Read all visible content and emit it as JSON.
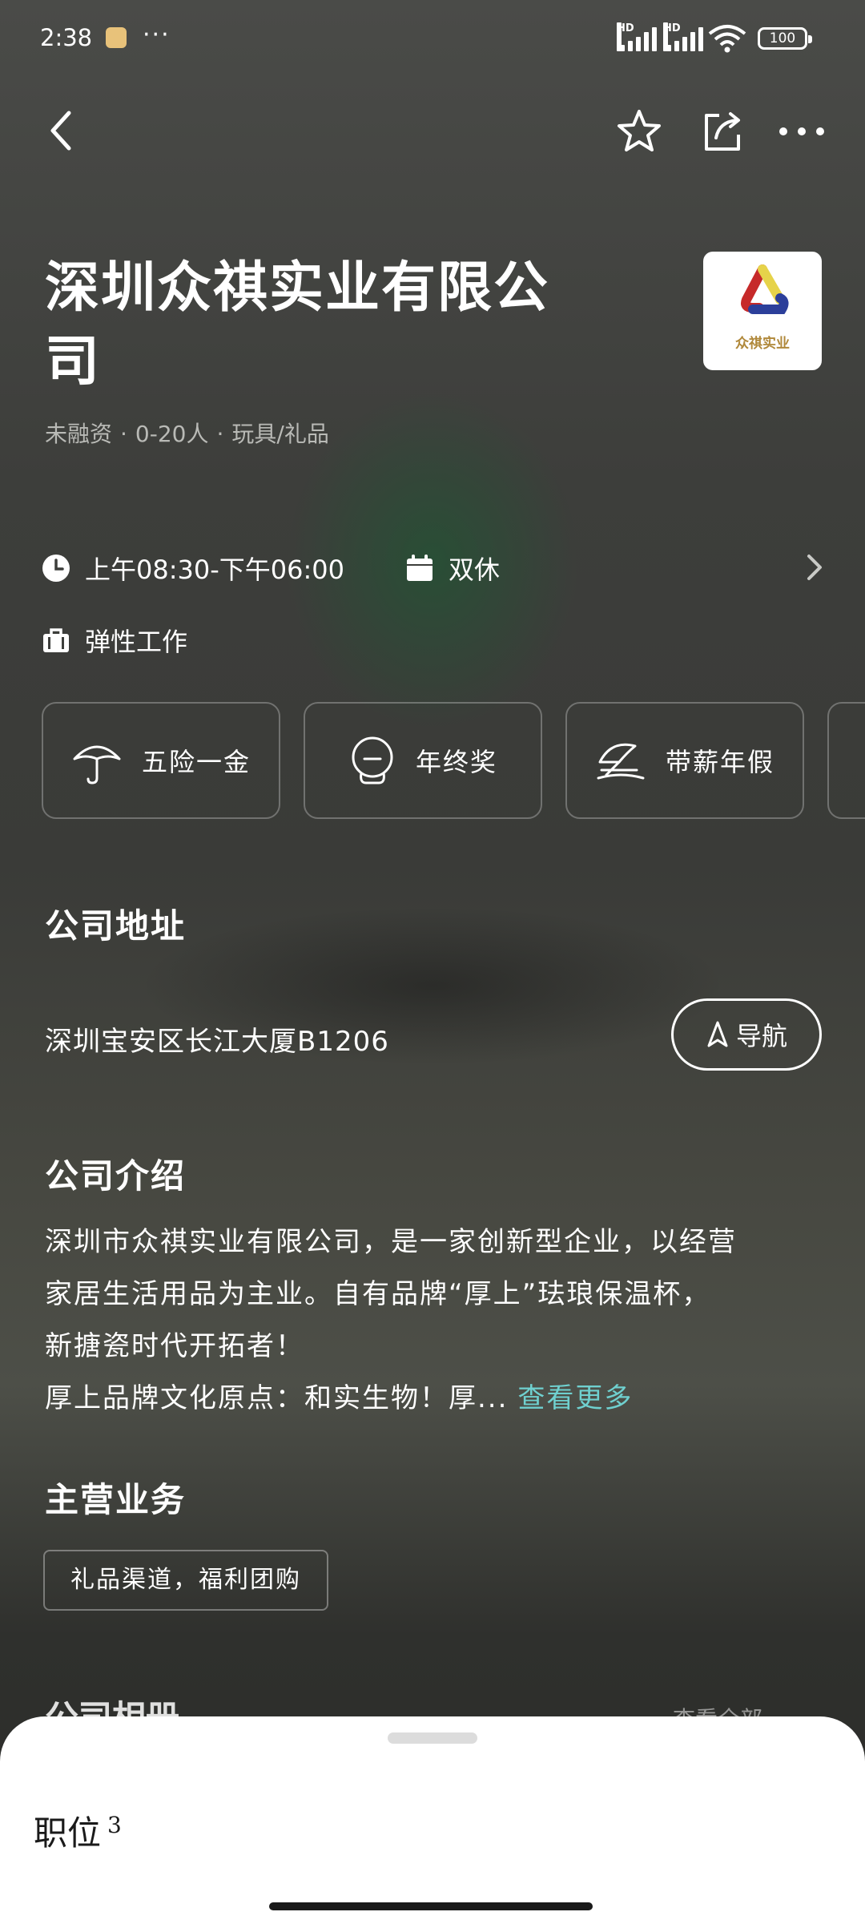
{
  "status_bar": {
    "time": "2:38",
    "overflow": "···",
    "signal_1_label": "HD",
    "signal_2_label": "HD",
    "battery": "100"
  },
  "header": {
    "back_icon": "chevron-left-icon",
    "favorite_icon": "star-icon",
    "share_icon": "share-icon",
    "more_icon": "more-horizontal-icon"
  },
  "company": {
    "name": "深圳众祺实业有限公司",
    "logo_text": "众祺实业",
    "funding": "未融资",
    "size": "0-20人",
    "industry": "玩具/礼品",
    "separator": "·"
  },
  "work": {
    "hours": "上午08:30-下午06:00",
    "rest": "双休",
    "flexible": "弹性工作"
  },
  "benefits": [
    {
      "label": "五险一金",
      "icon": "umbrella-icon"
    },
    {
      "label": "年终奖",
      "icon": "bonus-icon"
    },
    {
      "label": "带薪年假",
      "icon": "vacation-icon"
    }
  ],
  "address_section": {
    "title": "公司地址",
    "address": "深圳宝安区长江大厦B1206",
    "nav_label": "导航"
  },
  "intro_section": {
    "title": "公司介绍",
    "line1": "深圳市众祺实业有限公司，是一家创新型企业，以经营",
    "line2": "家居生活用品为主业。自有品牌“厚上”珐琅保温杯，",
    "line3": "新搪瓷时代开拓者！",
    "line4": "厚上品牌文化原点：和实生物！厚...",
    "more_label": "查看更多"
  },
  "business_section": {
    "title": "主营业务",
    "tag": "礼品渠道，福利团购"
  },
  "album_section": {
    "title": "公司相册",
    "more_label": "查看全部"
  },
  "bottom_sheet": {
    "title": "职位",
    "count": "3"
  }
}
